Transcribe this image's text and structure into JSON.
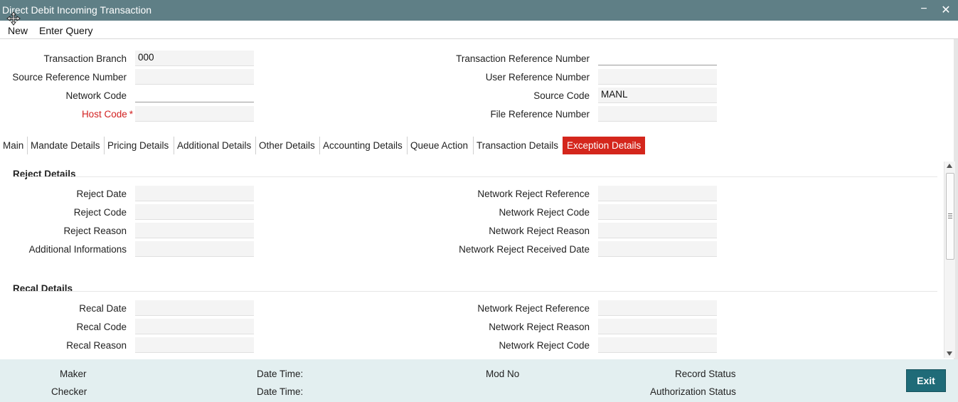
{
  "window": {
    "title": "Direct Debit Incoming Transaction",
    "minimize_symbol": "−",
    "close_symbol": "✕"
  },
  "menu": {
    "items": [
      "New",
      "Enter Query"
    ]
  },
  "header_fields": {
    "transaction_branch": {
      "label": "Transaction Branch",
      "value": "000"
    },
    "source_reference_number": {
      "label": "Source Reference Number",
      "value": ""
    },
    "network_code": {
      "label": "Network Code",
      "value": ""
    },
    "host_code": {
      "label": "Host Code",
      "value": "",
      "required_mark": "*"
    },
    "transaction_reference_number": {
      "label": "Transaction Reference Number",
      "value": ""
    },
    "user_reference_number": {
      "label": "User Reference Number",
      "value": ""
    },
    "source_code": {
      "label": "Source Code",
      "value": "MANL"
    },
    "file_reference_number": {
      "label": "File Reference Number",
      "value": ""
    }
  },
  "tabs": [
    {
      "label": "Main",
      "active": false
    },
    {
      "label": "Mandate Details",
      "active": false
    },
    {
      "label": "Pricing Details",
      "active": false
    },
    {
      "label": "Additional Details",
      "active": false
    },
    {
      "label": "Other Details",
      "active": false
    },
    {
      "label": "Accounting Details",
      "active": false
    },
    {
      "label": "Queue Action",
      "active": false
    },
    {
      "label": "Transaction Details",
      "active": false
    },
    {
      "label": "Exception Details",
      "active": true
    }
  ],
  "reject_details": {
    "title": "Reject Details",
    "left": [
      {
        "label": "Reject Date",
        "value": ""
      },
      {
        "label": "Reject Code",
        "value": ""
      },
      {
        "label": "Reject Reason",
        "value": ""
      },
      {
        "label": "Additional Informations",
        "value": ""
      }
    ],
    "right": [
      {
        "label": "Network Reject Reference",
        "value": ""
      },
      {
        "label": "Network Reject Code",
        "value": ""
      },
      {
        "label": "Network Reject Reason",
        "value": ""
      },
      {
        "label": "Network Reject Received Date",
        "value": ""
      }
    ]
  },
  "recal_details": {
    "title": "Recal Details",
    "left": [
      {
        "label": "Recal Date",
        "value": ""
      },
      {
        "label": "Recal Code",
        "value": ""
      },
      {
        "label": "Recal Reason",
        "value": ""
      }
    ],
    "right": [
      {
        "label": "Network Reject Reference",
        "value": ""
      },
      {
        "label": "Network Reject Reason",
        "value": ""
      },
      {
        "label": "Network Reject Code",
        "value": ""
      }
    ]
  },
  "footer": {
    "maker": "Maker",
    "checker": "Checker",
    "date_time_1": "Date Time:",
    "date_time_2": "Date Time:",
    "mod_no": "Mod No",
    "record_status": "Record Status",
    "authorization_status": "Authorization Status",
    "exit_label": "Exit"
  },
  "colors": {
    "titlebar": "#5f7f86",
    "active_tab": "#d4261c",
    "footer": "#e3eff0",
    "exit_button": "#1f6b78",
    "required": "#d21f1f"
  }
}
